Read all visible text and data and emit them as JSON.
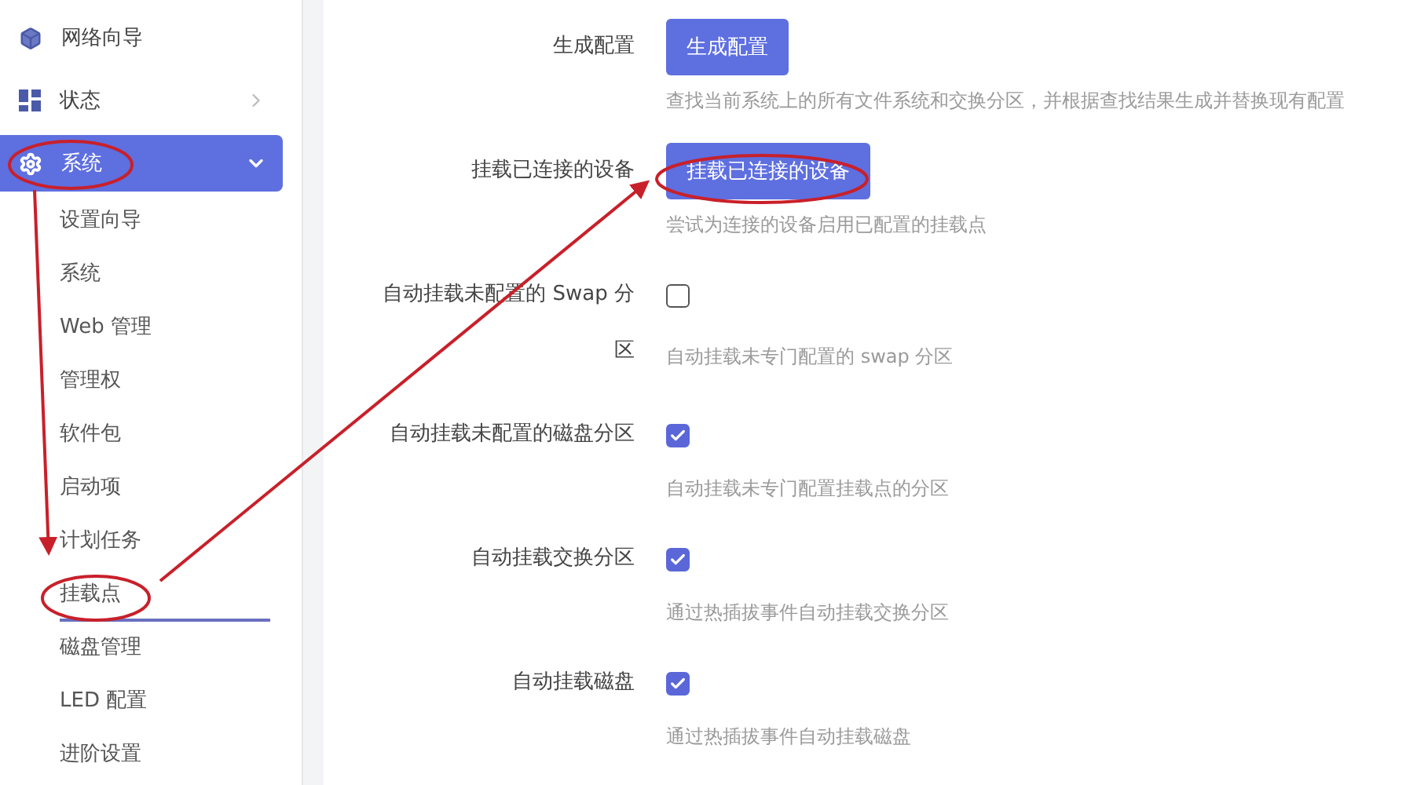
{
  "sidebar": {
    "items": [
      {
        "label": "网络向导",
        "kind": "link",
        "selected": false
      },
      {
        "label": "状态",
        "kind": "group",
        "expanded": false,
        "selected": false
      },
      {
        "label": "系统",
        "kind": "group",
        "expanded": true,
        "selected": true,
        "children": [
          {
            "label": "设置向导",
            "selected": false
          },
          {
            "label": "系统",
            "selected": false
          },
          {
            "label": "Web 管理",
            "selected": false
          },
          {
            "label": "管理权",
            "selected": false
          },
          {
            "label": "软件包",
            "selected": false
          },
          {
            "label": "启动项",
            "selected": false
          },
          {
            "label": "计划任务",
            "selected": false
          },
          {
            "label": "挂载点",
            "selected": true
          },
          {
            "label": "磁盘管理",
            "selected": false
          },
          {
            "label": "LED 配置",
            "selected": false
          },
          {
            "label": "进阶设置",
            "selected": false
          }
        ]
      }
    ]
  },
  "form": {
    "rows": [
      {
        "kind": "button",
        "label": "生成配置",
        "button": "生成配置",
        "description": "查找当前系统上的所有文件系统和交换分区，并根据查找结果生成并替换现有配置"
      },
      {
        "kind": "button",
        "label": "挂载已连接的设备",
        "button": "挂载已连接的设备",
        "description": "尝试为连接的设备启用已配置的挂载点"
      },
      {
        "kind": "checkbox",
        "label": "自动挂载未配置的 Swap 分区",
        "checked": false,
        "description": "自动挂载未专门配置的 swap 分区"
      },
      {
        "kind": "checkbox",
        "label": "自动挂载未配置的磁盘分区",
        "checked": true,
        "description": "自动挂载未专门配置挂载点的分区"
      },
      {
        "kind": "checkbox",
        "label": "自动挂载交换分区",
        "checked": true,
        "description": "通过热插拔事件自动挂载交换分区"
      },
      {
        "kind": "checkbox",
        "label": "自动挂载磁盘",
        "checked": true,
        "description": "通过热插拔事件自动挂载磁盘"
      }
    ]
  }
}
